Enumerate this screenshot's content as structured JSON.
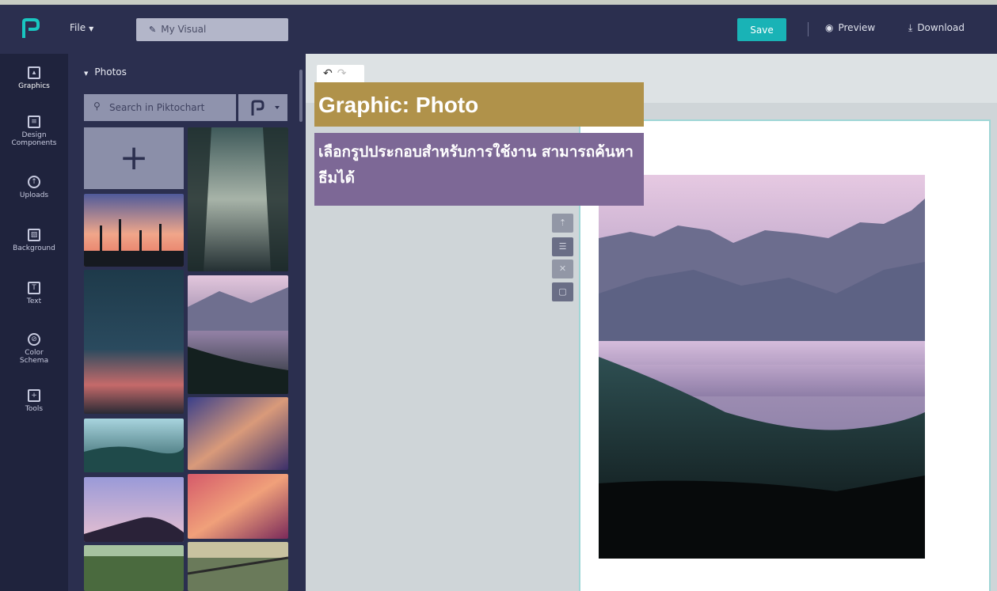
{
  "app": {
    "logo": "piktochart-logo-icon"
  },
  "topbar": {
    "file_label": "File",
    "title": "My Visual",
    "save_label": "Save",
    "preview_label": "Preview",
    "download_label": "Download"
  },
  "rail": {
    "items": [
      {
        "label": "Graphics",
        "icon": "image-icon"
      },
      {
        "label": "Design Components",
        "icon": "components-icon"
      },
      {
        "label": "Uploads",
        "icon": "cloud-upload-icon"
      },
      {
        "label": "Background",
        "icon": "background-pattern-icon"
      },
      {
        "label": "Text",
        "icon": "text-icon"
      },
      {
        "label": "Color Schema",
        "icon": "palette-icon"
      },
      {
        "label": "Tools",
        "icon": "toolbox-icon"
      }
    ]
  },
  "panel": {
    "section_title": "Photos",
    "search_placeholder": "Search in Piktochart",
    "add_symbol": "+"
  },
  "annotation": {
    "title": "Graphic: Photo",
    "description": "เลือกรูปประกอบสำหรับการใช้งาน สามารถค้นหาธีมได้"
  },
  "colors": {
    "topbar": "#2b2f4f",
    "rail": "#1f233d",
    "accent_save": "#19b3b6",
    "annotation_title_bg": "#b0924a",
    "annotation_desc_bg": "#7d6896"
  }
}
